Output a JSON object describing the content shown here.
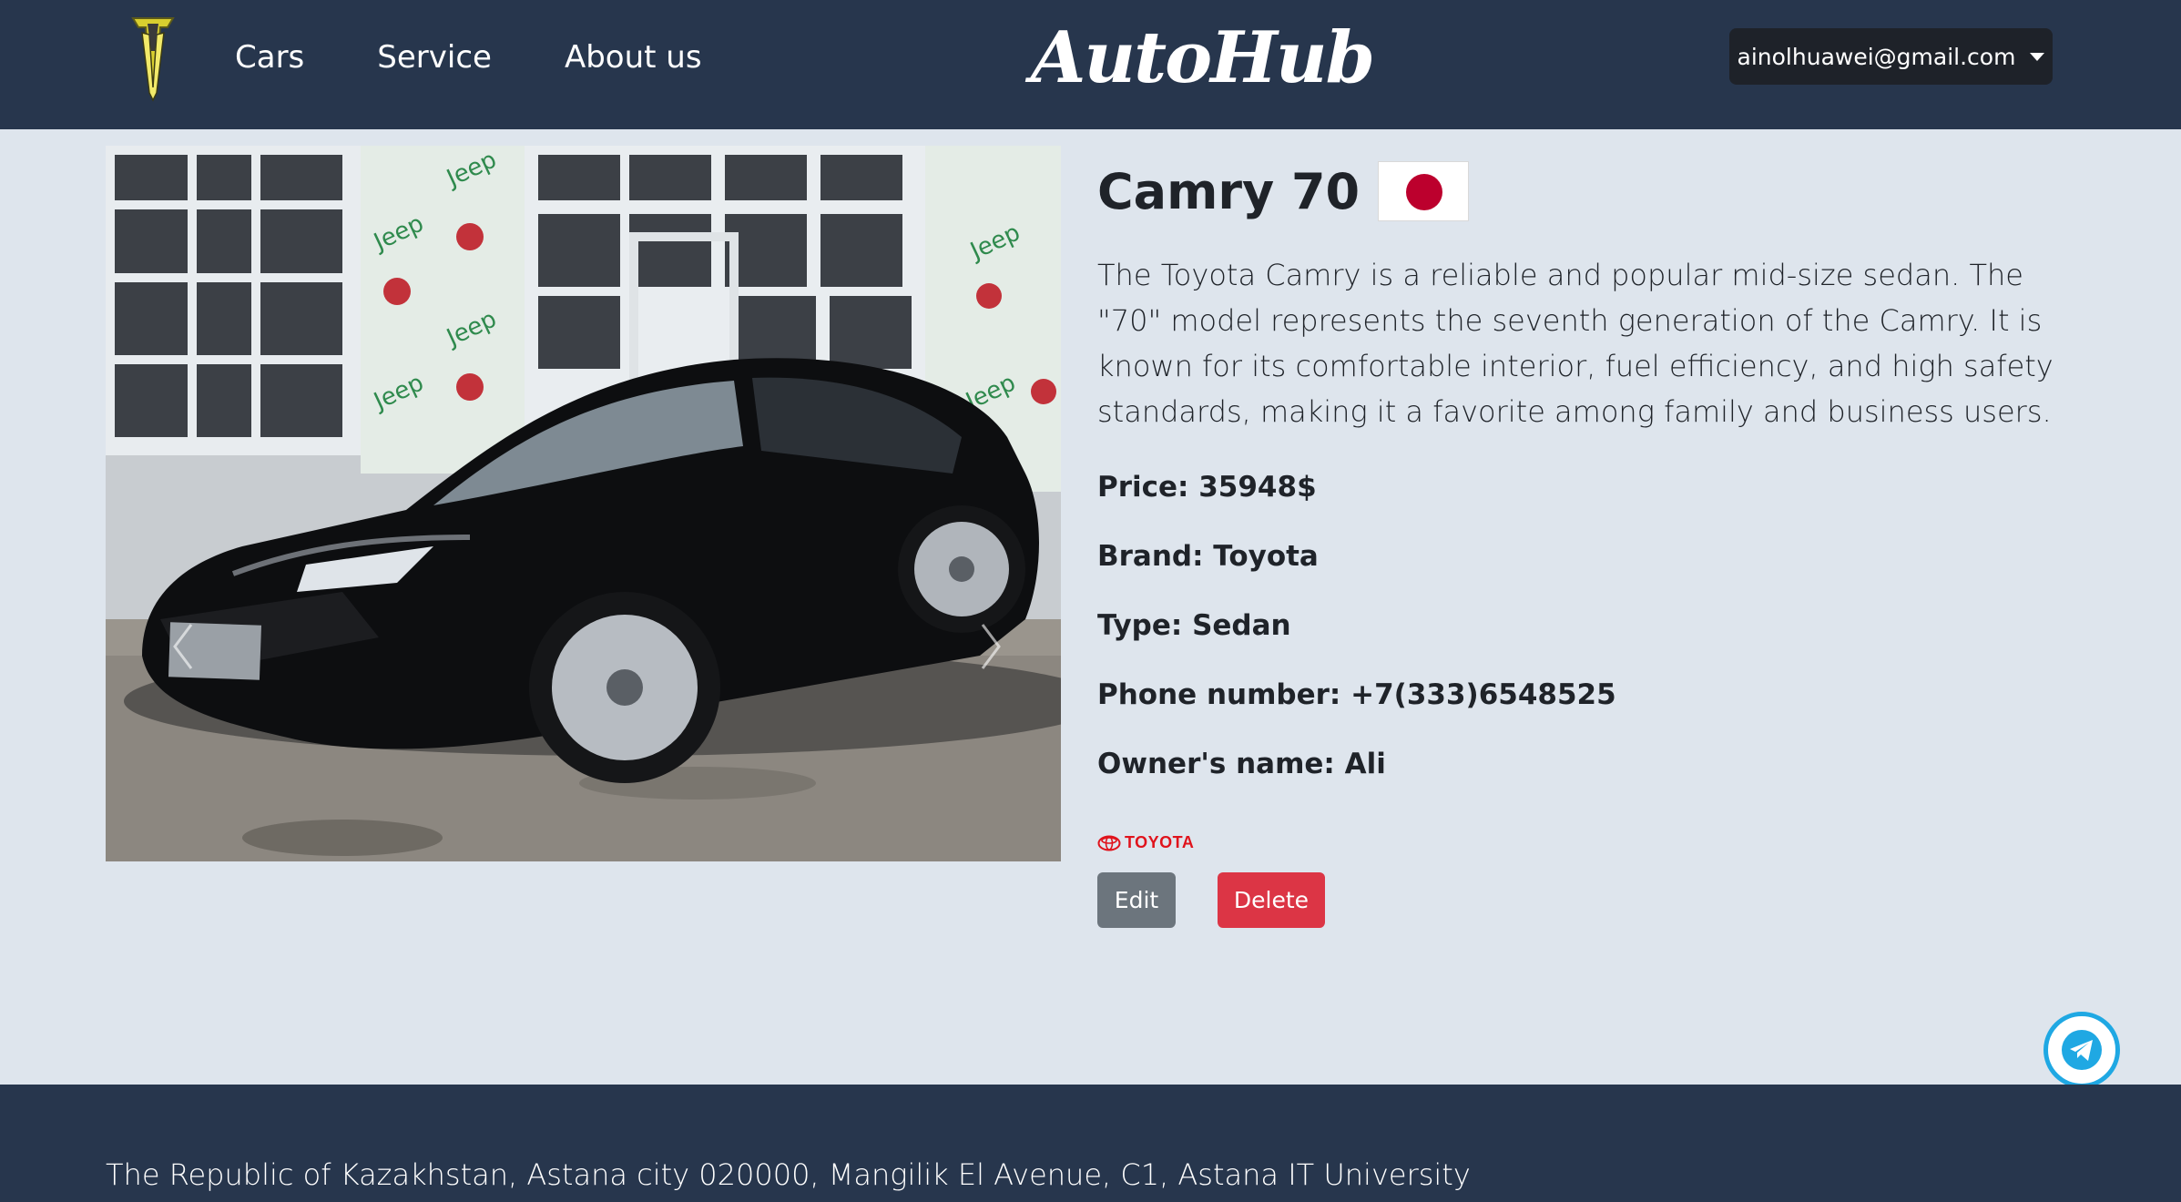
{
  "header": {
    "nav": [
      {
        "label": "Cars"
      },
      {
        "label": "Service"
      },
      {
        "label": "About us"
      }
    ],
    "brand": "AutoHub",
    "user_email": "ainolhuawei@gmail.com"
  },
  "car": {
    "title": "Camry 70",
    "flag": "japan-flag",
    "description": "The Toyota Camry is a reliable and popular mid-size sedan. The \"70\" model represents the seventh generation of the Camry. It is known for its comfortable interior, fuel efficiency, and high safety standards, making it a favorite among family and business users.",
    "price": "Price: 35948$",
    "brand": "Brand: Toyota",
    "type": "Type: Sedan",
    "phone": "Phone number: +7(333)6548525",
    "owner": "Owner's name: Ali",
    "brand_logo_text": "TOYOTA"
  },
  "actions": {
    "edit_label": "Edit",
    "delete_label": "Delete"
  },
  "footer": {
    "address": "The Republic of Kazakhstan, Astana city 020000, Mangilik El Avenue, C1, Astana IT University"
  },
  "colors": {
    "navbar": "#27364d",
    "page_bg": "#dee5ed",
    "edit_button": "#6c757d",
    "delete_button": "#dc3545",
    "telegram": "#1fa8e3"
  }
}
